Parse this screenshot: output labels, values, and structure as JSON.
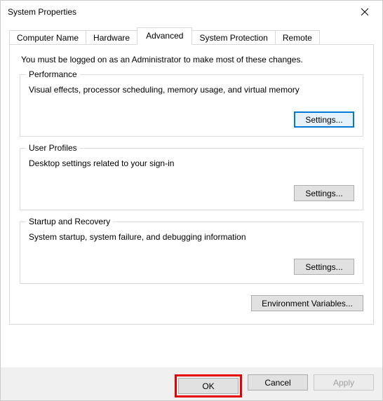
{
  "titlebar": {
    "title": "System Properties"
  },
  "tabs": {
    "computer_name": "Computer Name",
    "hardware": "Hardware",
    "advanced": "Advanced",
    "system_protection": "System Protection",
    "remote": "Remote"
  },
  "intro": "You must be logged on as an Administrator to make most of these changes.",
  "performance": {
    "legend": "Performance",
    "desc": "Visual effects, processor scheduling, memory usage, and virtual memory",
    "button": "Settings..."
  },
  "user_profiles": {
    "legend": "User Profiles",
    "desc": "Desktop settings related to your sign-in",
    "button": "Settings..."
  },
  "startup_recovery": {
    "legend": "Startup and Recovery",
    "desc": "System startup, system failure, and debugging information",
    "button": "Settings..."
  },
  "env_vars_button": "Environment Variables...",
  "buttons": {
    "ok": "OK",
    "cancel": "Cancel",
    "apply": "Apply"
  }
}
